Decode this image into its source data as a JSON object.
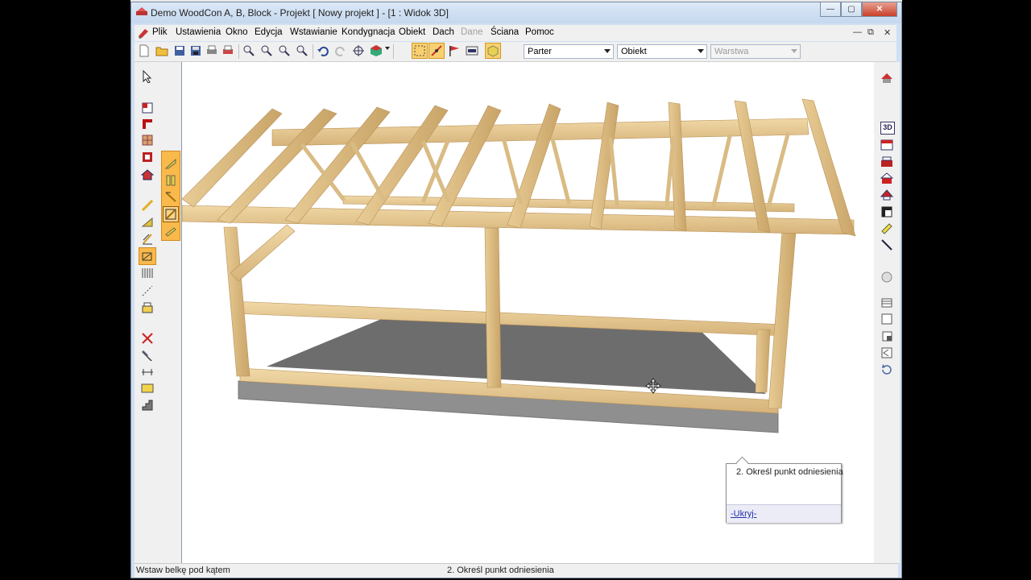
{
  "window": {
    "title": "Demo WoodCon A, B, Block - Projekt [ Nowy projekt ]  - [1 : Widok 3D]"
  },
  "menu": {
    "items": [
      "Plik",
      "Ustawienia",
      "Okno",
      "Edycja",
      "Wstawianie",
      "Kondygnacja",
      "Obiekt",
      "Dach",
      "Dane",
      "Ściana",
      "Pomoc"
    ],
    "disabled": [
      "Dane"
    ]
  },
  "toolbar": {
    "floor_select": "Parter",
    "object_select": "Obiekt",
    "layer_select": "Warstwa"
  },
  "hint": {
    "text": "2. Określ punkt odniesienia",
    "link": "-Ukryj-"
  },
  "status": {
    "left": "Wstaw belkę pod kątem",
    "center": "2. Określ punkt odniesienia"
  },
  "colors": {
    "wood": "#e3c48b",
    "floor": "#6d6d6d",
    "foundation": "#9a9a9a",
    "window_frame": "#cfe0f2",
    "toolbar_highlight": "#f9b94b"
  },
  "icons": {
    "left": [
      "select-arrow-icon",
      "wall-icon",
      "corner-wall-icon",
      "window-icon",
      "door-icon",
      "house-icon",
      "beam-icon",
      "rafter-icon",
      "column-icon",
      "angled-beam-icon",
      "joist-icon",
      "dotted-line-icon",
      "hatch-icon",
      "delete-icon",
      "tools-icon",
      "dimension-icon",
      "numbering-icon",
      "stairs-icon"
    ],
    "right": [
      "roof-view-icon",
      "3d-view-icon",
      "building-icon",
      "house-red-icon",
      "house-icon",
      "roof-icon",
      "profile-icon",
      "beam-yellow-icon",
      "line-icon",
      "3d-disc-icon",
      "grid-icon",
      "square-icon",
      "shadow-icon",
      "zoom-icon",
      "rotate-icon"
    ]
  }
}
